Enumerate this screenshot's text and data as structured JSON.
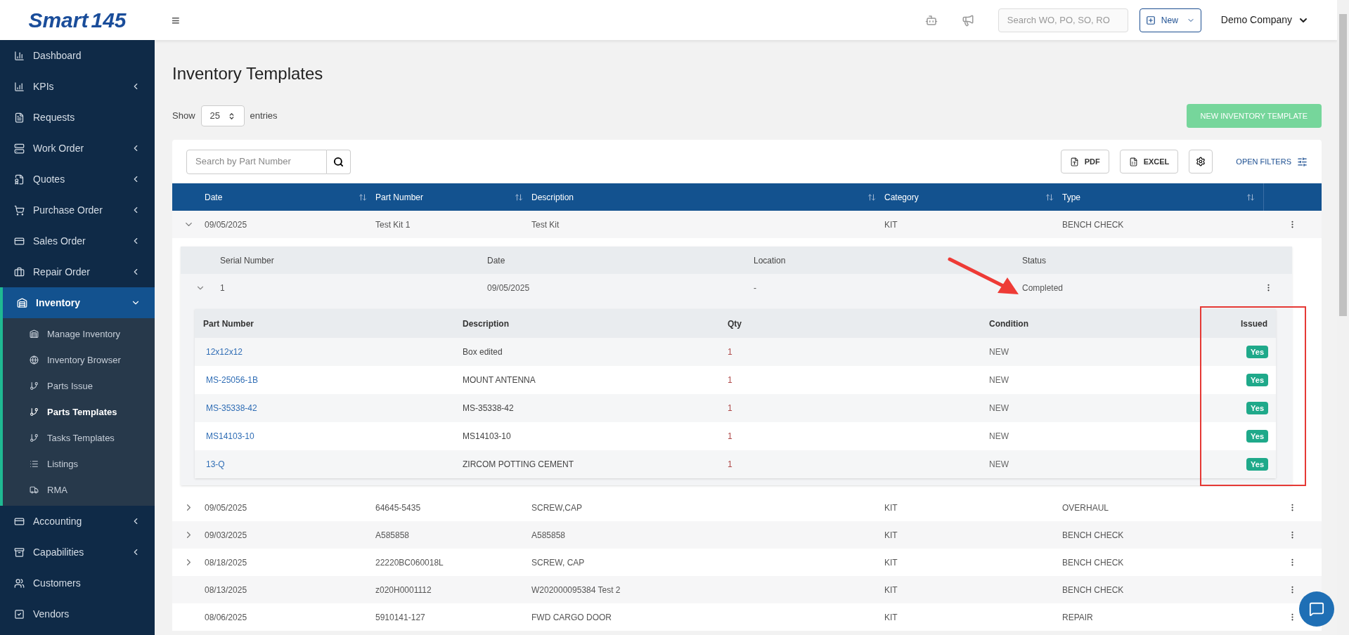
{
  "logo": {
    "word": "Smart",
    "number": "145"
  },
  "sidebar": {
    "items": [
      {
        "label": "Dashboard",
        "has_submenu": false,
        "selected": false
      },
      {
        "label": "KPIs",
        "has_submenu": true,
        "selected": false
      },
      {
        "label": "Requests",
        "has_submenu": false,
        "selected": false
      },
      {
        "label": "Work Order",
        "has_submenu": true,
        "selected": false
      },
      {
        "label": "Quotes",
        "has_submenu": true,
        "selected": false
      },
      {
        "label": "Purchase Order",
        "has_submenu": true,
        "selected": false
      },
      {
        "label": "Sales Order",
        "has_submenu": true,
        "selected": false
      },
      {
        "label": "Repair Order",
        "has_submenu": true,
        "selected": false
      },
      {
        "label": "Inventory",
        "has_submenu": true,
        "selected": true,
        "expanded": true,
        "children": [
          {
            "label": "Manage Inventory",
            "selected": false
          },
          {
            "label": "Inventory Browser",
            "selected": false
          },
          {
            "label": "Parts Issue",
            "selected": false
          },
          {
            "label": "Parts Templates",
            "selected": true
          },
          {
            "label": "Tasks Templates",
            "selected": false
          },
          {
            "label": "Listings",
            "selected": false
          },
          {
            "label": "RMA",
            "selected": false
          }
        ]
      },
      {
        "label": "Accounting",
        "has_submenu": true,
        "selected": false
      },
      {
        "label": "Capabilities",
        "has_submenu": true,
        "selected": false
      },
      {
        "label": "Customers",
        "has_submenu": false,
        "selected": false
      },
      {
        "label": "Vendors",
        "has_submenu": false,
        "selected": false
      }
    ]
  },
  "topbar": {
    "menu_glyph": "≡",
    "search": {
      "placeholder": "Search WO, PO, SO, RO"
    },
    "new_button": "New",
    "company": "Demo Company"
  },
  "page": {
    "title": "Inventory Templates",
    "show_label": "Show",
    "entries_value": "25",
    "entries_label": "entries",
    "new_button": "NEW INVENTORY TEMPLATE"
  },
  "toolbar": {
    "search": {
      "placeholder": "Search by Part Number"
    },
    "pdf": "PDF",
    "excel": "EXCEL",
    "filters": "OPEN FILTERS"
  },
  "table": {
    "columns": [
      "Date",
      "Part Number",
      "Description",
      "Category",
      "Type"
    ],
    "rows": [
      {
        "date": "09/05/2025",
        "part_number": "Test Kit 1",
        "description": "Test Kit",
        "category": "KIT",
        "type": "BENCH CHECK",
        "expanded": true,
        "detail": {
          "columns": [
            "Serial Number",
            "Date",
            "Location",
            "Status"
          ],
          "rows": [
            {
              "serial_number": "1",
              "date": "09/05/2025",
              "location": "-",
              "status": "Completed",
              "expanded": true,
              "items": {
                "columns": [
                  "Part Number",
                  "Description",
                  "Qty",
                  "Condition",
                  "Issued"
                ],
                "rows": [
                  {
                    "part_number": "12x12x12",
                    "description": "Box edited",
                    "qty": "1",
                    "condition": "NEW",
                    "issued": "Yes"
                  },
                  {
                    "part_number": "MS-25056-1B",
                    "description": "MOUNT ANTENNA",
                    "qty": "1",
                    "condition": "NEW",
                    "issued": "Yes"
                  },
                  {
                    "part_number": "MS-35338-42",
                    "description": "MS-35338-42",
                    "qty": "1",
                    "condition": "NEW",
                    "issued": "Yes"
                  },
                  {
                    "part_number": "MS14103-10",
                    "description": "MS14103-10",
                    "qty": "1",
                    "condition": "NEW",
                    "issued": "Yes"
                  },
                  {
                    "part_number": "13-Q",
                    "description": "ZIRCOM POTTING CEMENT",
                    "qty": "1",
                    "condition": "NEW",
                    "issued": "Yes"
                  }
                ]
              }
            }
          ]
        }
      },
      {
        "date": "09/05/2025",
        "part_number": "64645-5435",
        "description": "SCREW,CAP",
        "category": "KIT",
        "type": "OVERHAUL",
        "expanded": false
      },
      {
        "date": "09/03/2025",
        "part_number": "A585858",
        "description": "A585858",
        "category": "KIT",
        "type": "BENCH CHECK",
        "expanded": false
      },
      {
        "date": "08/18/2025",
        "part_number": "22220BC060018L",
        "description": "SCREW, CAP",
        "category": "KIT",
        "type": "BENCH CHECK",
        "expanded": false
      },
      {
        "date": "08/13/2025",
        "part_number": "z020H0001112",
        "description": "W202000095384 Test 2",
        "category": "KIT",
        "type": "BENCH CHECK"
      },
      {
        "date": "08/06/2025",
        "part_number": "5910141-127",
        "description": "FWD CARGO DOOR",
        "category": "KIT",
        "type": "REPAIR"
      }
    ]
  }
}
